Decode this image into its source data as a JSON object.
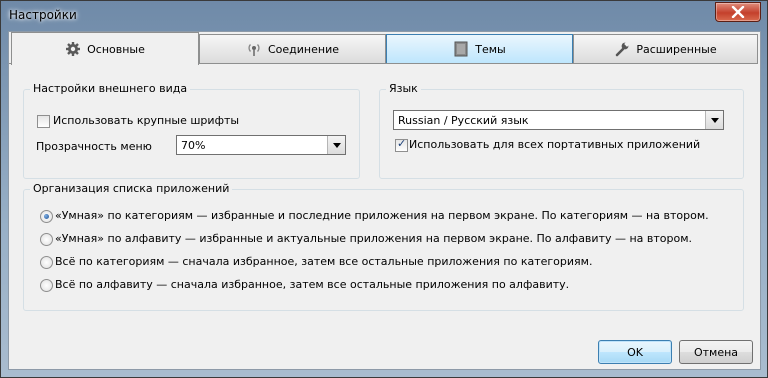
{
  "window": {
    "title": "Настройки"
  },
  "tabs": [
    {
      "label": "Основные",
      "icon": "gear-icon"
    },
    {
      "label": "Соединение",
      "icon": "broadcast-icon"
    },
    {
      "label": "Темы",
      "icon": "theme-icon"
    },
    {
      "label": "Расширенные",
      "icon": "wrench-icon"
    }
  ],
  "appearance": {
    "legend": "Настройки внешнего вида",
    "large_fonts_label": "Использовать крупные шрифты",
    "large_fonts_checked": false,
    "transparency_label": "Прозрачность меню",
    "transparency_value": "70%"
  },
  "language": {
    "legend": "Язык",
    "value": "Russian / Русский язык",
    "portable_label": "Использовать для всех портативных приложений",
    "portable_checked": true
  },
  "organization": {
    "legend": "Организация списка приложений",
    "options": [
      {
        "label": "«Умная» по категориям — избранные и последние приложения на первом экране. По категориям — на втором.",
        "checked": true
      },
      {
        "label": "«Умная» по алфавиту — избранные и актуальные приложения на первом экране. По алфавиту — на втором.",
        "checked": false
      },
      {
        "label": "Всё по категориям — сначала избранное, затем все остальные приложения по категориям.",
        "checked": false
      },
      {
        "label": "Всё по алфавиту — сначала избранное, затем все остальные приложения по алфавиту.",
        "checked": false
      }
    ]
  },
  "footer": {
    "ok_label": "OK",
    "cancel_label": "Отмена"
  }
}
